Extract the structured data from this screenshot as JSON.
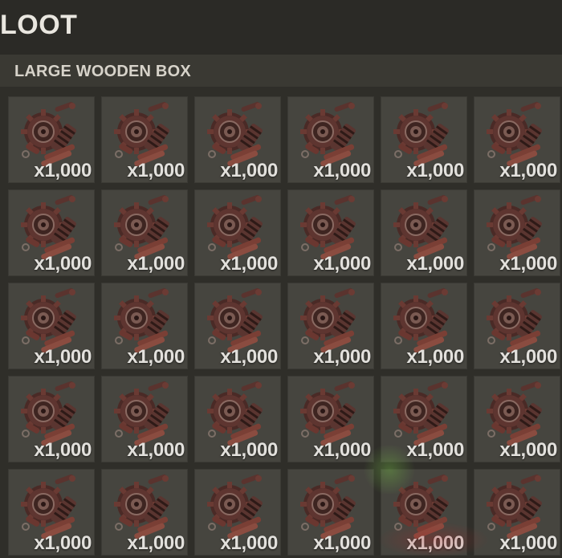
{
  "window": {
    "title": "LOOT"
  },
  "container": {
    "title": "LARGE WOODEN BOX"
  },
  "item": {
    "icon": "gears-icon",
    "quantity": "x1,000"
  },
  "grid": {
    "rows": 5,
    "columns": 6
  },
  "colors": {
    "slot": "#46453f",
    "gear": "#6a3a33",
    "text": "#e2e0dc"
  }
}
